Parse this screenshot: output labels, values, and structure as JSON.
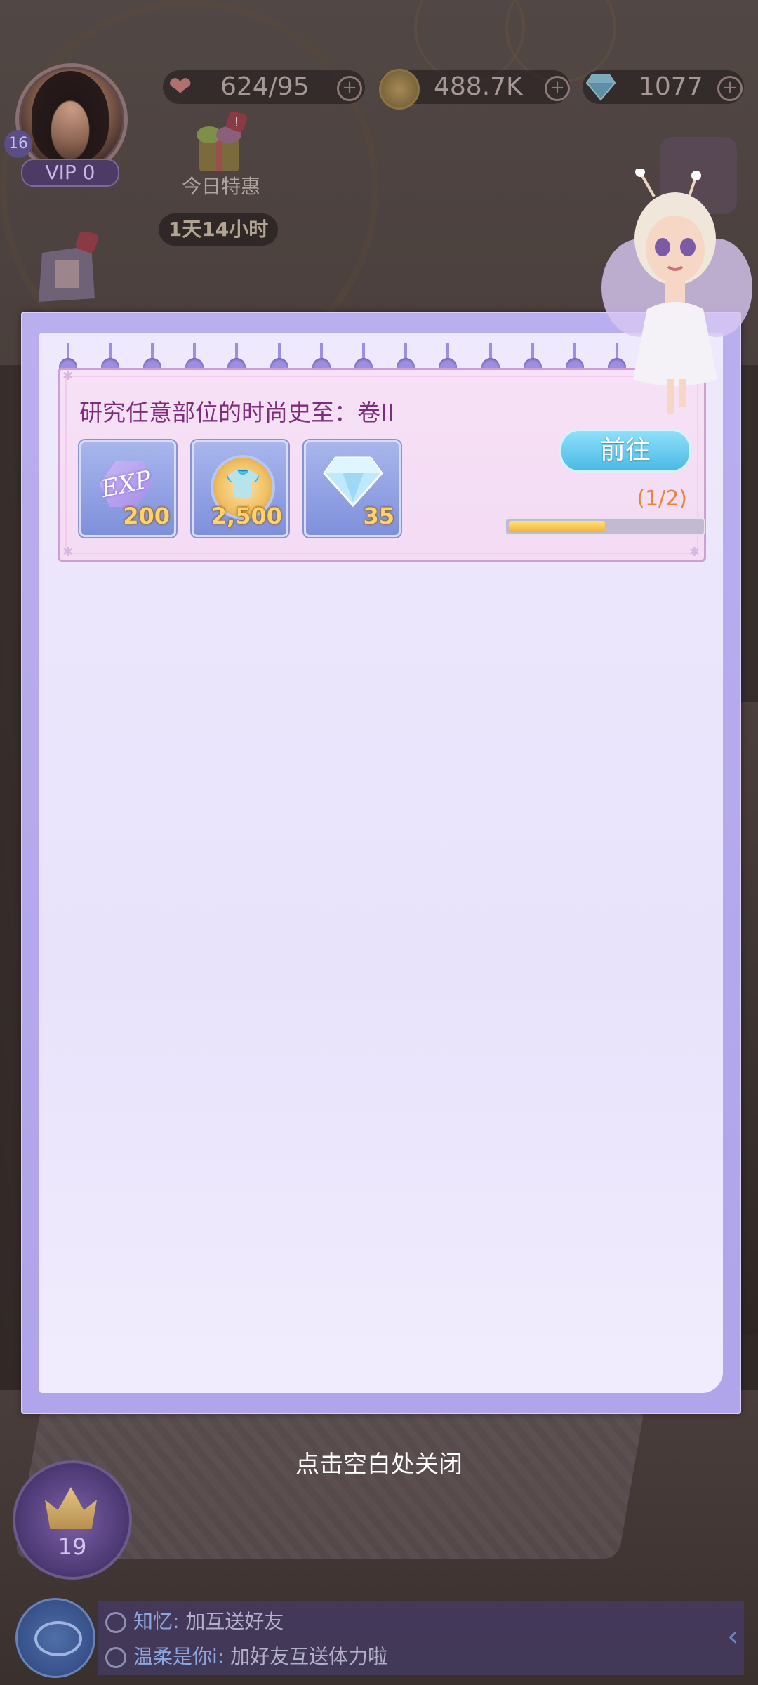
{
  "hud": {
    "player_level": "16",
    "vip_label": "VIP 0",
    "stamina": "624/95",
    "coins": "488.7K",
    "diamonds": "1077",
    "daily_deal_label": "今日特惠",
    "daily_deal_timer": "1天14小时",
    "icons": [
      "heart-icon",
      "coin-icon",
      "diamond-icon",
      "plus-icon",
      "gift-icon"
    ]
  },
  "task": {
    "title": "研究任意部位的时尚史至：卷II",
    "rewards": [
      {
        "type": "exp",
        "icon": "exp-icon",
        "amount": "200"
      },
      {
        "type": "coin",
        "icon": "shirt-coin-icon",
        "amount": "2,500"
      },
      {
        "type": "diamond",
        "icon": "diamond-icon",
        "amount": "35"
      }
    ],
    "go_label": "前往",
    "progress_text": "(1/2)",
    "progress_fraction": 0.5
  },
  "close_hint": "点击空白处关闭",
  "bottom": {
    "level_number": "19",
    "chat": [
      {
        "name": "知忆:",
        "message": "加互送好友"
      },
      {
        "name": "温柔是你i:",
        "message": "加好友互送体力啦"
      }
    ]
  },
  "colors": {
    "modal_frame": "#b9aeee",
    "paper": "#efe9fd",
    "task_title": "#7d2e7a",
    "go_button": "#4bb9e6",
    "progress_fill": "#f0b236",
    "progress_text": "#e8853a"
  }
}
